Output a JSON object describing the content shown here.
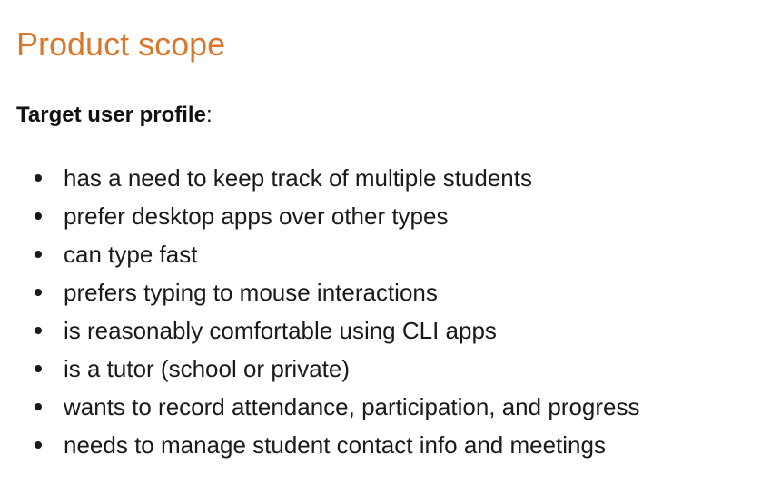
{
  "section": {
    "title": "Product scope",
    "profile_label": "Target user profile",
    "profile_suffix": ":",
    "items": [
      "has a need to keep track of multiple students",
      "prefer desktop apps over other types",
      "can type fast",
      "prefers typing to mouse interactions",
      "is reasonably comfortable using CLI apps",
      "is a tutor (school or private)",
      "wants to record attendance, participation, and progress",
      "needs to manage student contact info and meetings"
    ]
  },
  "colors": {
    "heading": "#d9782d",
    "text": "#1a1a1a",
    "background": "#ffffff"
  }
}
